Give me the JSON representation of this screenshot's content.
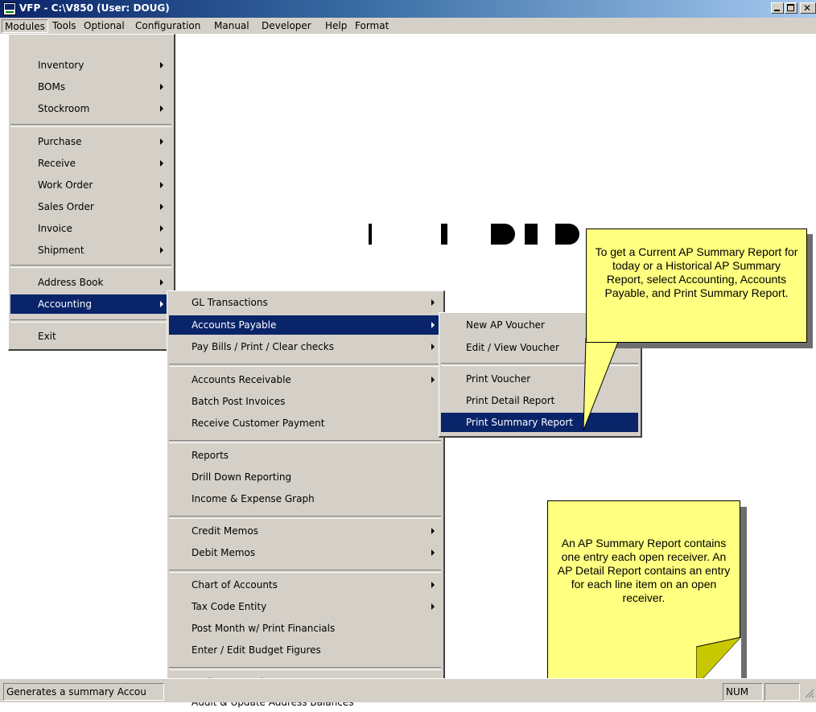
{
  "window": {
    "title": "VFP - C:\\V850  (User: DOUG)",
    "app_icon": "vfp-app-icon",
    "controls": [
      "minimize-icon",
      "maximize-icon",
      "close-icon"
    ]
  },
  "menubar": {
    "items": [
      "Modules",
      "Tools",
      "Optional",
      "Configuration",
      "Manual",
      "Developer",
      "Help",
      "Format"
    ],
    "active": "Modules"
  },
  "modules_menu": {
    "items": [
      {
        "label": "Inventory",
        "submenu": true
      },
      {
        "label": "BOMs",
        "submenu": true
      },
      {
        "label": "Stockroom",
        "submenu": true
      },
      {
        "label": "Purchase",
        "submenu": true
      },
      {
        "label": "Receive",
        "submenu": true
      },
      {
        "label": "Work Order",
        "submenu": true
      },
      {
        "label": "Sales Order",
        "submenu": true
      },
      {
        "label": "Invoice",
        "submenu": true
      },
      {
        "label": "Shipment",
        "submenu": true
      },
      {
        "label": "Address Book",
        "submenu": true
      },
      {
        "label": "Accounting",
        "submenu": true,
        "highlighted": true
      },
      {
        "label": "Exit",
        "submenu": false
      }
    ]
  },
  "accounting_menu": {
    "items": [
      {
        "label": "GL Transactions",
        "submenu": true
      },
      {
        "label": "Accounts Payable",
        "submenu": true,
        "highlighted": true
      },
      {
        "label": "Pay Bills / Print / Clear checks",
        "submenu": true
      },
      {
        "label": "Accounts Receivable",
        "submenu": true
      },
      {
        "label": "Batch Post Invoices",
        "submenu": false
      },
      {
        "label": "Receive Customer Payment",
        "submenu": false
      },
      {
        "label": "Reports",
        "submenu": false
      },
      {
        "label": "Drill Down Reporting",
        "submenu": false
      },
      {
        "label": "Income & Expense Graph",
        "submenu": false
      },
      {
        "label": "Credit Memos",
        "submenu": true
      },
      {
        "label": "Debit Memos",
        "submenu": true
      },
      {
        "label": "Chart of Accounts",
        "submenu": true
      },
      {
        "label": "Tax Code Entity",
        "submenu": true
      },
      {
        "label": "Post Month w/ Print Financials",
        "submenu": false
      },
      {
        "label": "Enter / Edit Budget Figures",
        "submenu": false
      },
      {
        "label": "Audit Transactions",
        "submenu": false
      },
      {
        "label": "Audit & Update Address Balances",
        "submenu": false
      }
    ]
  },
  "ap_menu": {
    "items": [
      {
        "label": "New AP Voucher"
      },
      {
        "label": "Edit / View Voucher"
      },
      {
        "label": "Print Voucher"
      },
      {
        "label": "Print Detail Report"
      },
      {
        "label": "Print Summary Report",
        "highlighted": true
      }
    ]
  },
  "callouts": {
    "top": "To get a Current AP Summary Report for today or a Historical AP Summary Report, select Accounting, Accounts Payable, and Print Summary Report.",
    "bottom": "An AP Summary Report contains one entry each open receiver.  An AP Detail Report contains an entry for each line item on an open receiver."
  },
  "statusbar": {
    "message": "Generates a summary Accou",
    "indicator": "NUM"
  },
  "colors": {
    "menu_bg": "#d4d0c8",
    "highlight": "#0a246a",
    "callout_bg": "#ffff80",
    "title_start": "#0a246a",
    "title_end": "#a6caf0"
  }
}
